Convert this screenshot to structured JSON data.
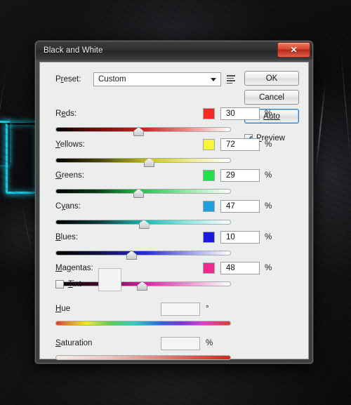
{
  "desktop": {
    "cyan_accent_color": "#16c6e0",
    "background_color": "#0b0b0d"
  },
  "dialog": {
    "title": "Black and White",
    "close_label": "✕",
    "preset": {
      "label": "P",
      "label_underlined": "r",
      "label_rest": "eset:",
      "full_label": "Preset:",
      "value": "Custom",
      "menu_icon": "preset-options-icon",
      "arrow_icon": "chevron-down-icon"
    },
    "buttons": {
      "ok": "OK",
      "cancel": "Cancel",
      "auto": "Auto"
    },
    "preview": {
      "label": "Preview",
      "checked": true
    },
    "sliders": [
      {
        "name": "reds",
        "label": "Reds:",
        "label_pre": "R",
        "label_key": "e",
        "label_post": "ds:",
        "value": "30",
        "unit": "%",
        "swatch_color": "#f92a24",
        "thumb_percent": 47,
        "gradient": "linear-gradient(to right, #000000 0%, #6b0d0a 22%, #d22020 50%, #f08080 74%, #ffffff 100%)"
      },
      {
        "name": "yellows",
        "label": "Yellows:",
        "label_pre": "",
        "label_key": "Y",
        "label_post": "ellows:",
        "value": "72",
        "unit": "%",
        "swatch_color": "#f9f63a",
        "thumb_percent": 53,
        "gradient": "linear-gradient(to right, #000000 0%, #4a4608 25%, #cfc81f 55%, #eeea8a 76%, #ffffff 100%)"
      },
      {
        "name": "greens",
        "label": "Greens:",
        "label_pre": "",
        "label_key": "G",
        "label_post": "reens:",
        "value": "29",
        "unit": "%",
        "swatch_color": "#21e048",
        "thumb_percent": 47,
        "gradient": "linear-gradient(to right, #000000 0%, #0a4017 24%, #23c04a 48%, #8ee6a2 74%, #ffffff 100%)"
      },
      {
        "name": "cyans",
        "label": "Cyans:",
        "label_pre": "C",
        "label_key": "y",
        "label_post": "ans:",
        "value": "47",
        "unit": "%",
        "swatch_color": "#1f9ee0",
        "thumb_percent": 50,
        "gradient": "linear-gradient(to right, #000000 0%, #0b3c3c 25%, #18c0b8 52%, #8fe8e4 76%, #ffffff 100%)"
      },
      {
        "name": "blues",
        "label": "Blues:",
        "label_pre": "",
        "label_key": "B",
        "label_post": "lues:",
        "value": "10",
        "unit": "%",
        "swatch_color": "#1a1ae0",
        "thumb_percent": 43,
        "gradient": "linear-gradient(to right, #000000 0%, #10103c 22%, #2a2ae0 52%, #9a9ae8 76%, #ffffff 100%)"
      },
      {
        "name": "magentas",
        "label": "Magentas:",
        "label_pre": "",
        "label_key": "M",
        "label_post": "agentas:",
        "value": "48",
        "unit": "%",
        "swatch_color": "#f0298f",
        "thumb_percent": 49,
        "gradient": "linear-gradient(to right, #000000 0%, #3c0a28 22%, #e020a8 52%, #f094d4 76%, #ffffff 100%)"
      }
    ],
    "tint": {
      "label": "Tint",
      "label_key": "T",
      "label_post": "int",
      "checked": false,
      "swatch_color": "#f3f4f4"
    },
    "hue": {
      "label": "Hue",
      "label_key": "H",
      "label_post": "ue",
      "value": "",
      "unit": "°",
      "gradient": "linear-gradient(to right, #e03c28 0%, #e8a02a 9%, #ece63a 18%, #5ad04a 31%, #2ecfc4 45%, #2a6ae0 60%, #7a34d8 72%, #e040d0 85%, #e03c28 100%)"
    },
    "saturation": {
      "label": "Saturation",
      "label_key": "S",
      "label_post": "aturation",
      "value": "",
      "unit": "%",
      "gradient": "linear-gradient(to right, #f5eceb 0%, #eec4bf 30%, #dd8478 60%, #d4402e 90%, #cc2a1c 100%)"
    }
  }
}
